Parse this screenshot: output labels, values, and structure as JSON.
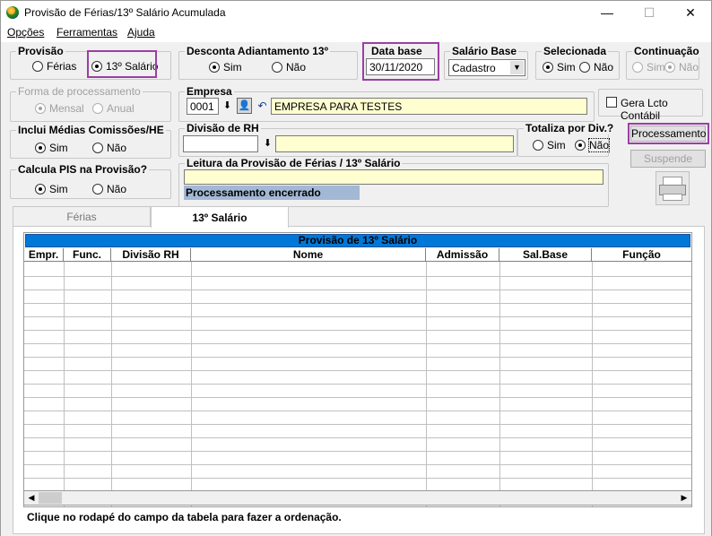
{
  "window": {
    "title": "Provisão de Férias/13º Salário Acumulada",
    "minimize": "—",
    "maximize": "☐",
    "close": "✕"
  },
  "menu": [
    {
      "label": "Opções",
      "key": "O"
    },
    {
      "label": "Ferramentas",
      "key": "F"
    },
    {
      "label": "Ajuda",
      "key": "A"
    }
  ],
  "provisao": {
    "label": "Provisão",
    "ferias": "Férias",
    "salario13": "13º Salário",
    "selected": "13º Salário"
  },
  "desconta": {
    "label": "Desconta Adiantamento 13º",
    "sim": "Sim",
    "nao": "Não",
    "selected": "Sim"
  },
  "data_base": {
    "label": "Data base",
    "value": "30/11/2020"
  },
  "salario_base": {
    "label": "Salário Base",
    "value": "Cadastro"
  },
  "selecionada": {
    "label": "Selecionada",
    "sim": "Sim",
    "nao": "Não",
    "selected": "Sim"
  },
  "continuacao": {
    "label": "Continuação",
    "sim": "Sim",
    "nao": "Não",
    "selected": "Não"
  },
  "forma": {
    "label": "Forma de processamento",
    "mensal": "Mensal",
    "anual": "Anual",
    "selected": "Mensal"
  },
  "empresa": {
    "label": "Empresa",
    "code": "0001",
    "name": "EMPRESA PARA TESTES"
  },
  "gera_lcto": {
    "label": "Gera Lcto Contábil",
    "checked": false
  },
  "inclui": {
    "label": "Inclui Médias Comissões/HE",
    "sim": "Sim",
    "nao": "Não",
    "selected": "Sim"
  },
  "divisao": {
    "label": "Divisão de RH",
    "code": "",
    "name": ""
  },
  "totaliza": {
    "label": "Totaliza por Div.?",
    "sim": "Sim",
    "nao": "Não",
    "selected": "Não"
  },
  "buttons": {
    "processamento": "Processamento",
    "suspende": "Suspende"
  },
  "calcula_pis": {
    "label": "Calcula PIS na Provisão?",
    "sim": "Sim",
    "nao": "Não",
    "selected": "Sim"
  },
  "leitura": {
    "label": "Leitura da Provisão de Férias / 13º Salário",
    "value": "",
    "status": "Processamento encerrado"
  },
  "tabs": [
    {
      "label": "Férias",
      "active": false
    },
    {
      "label": "13º Salário",
      "active": true
    }
  ],
  "grid": {
    "title": "Provisão de 13º Salário",
    "columns": [
      "Empr.",
      "Func.",
      "Divisão RH",
      "Nome",
      "Admissão",
      "Sal.Base",
      "Função"
    ]
  },
  "footer": "Clique no rodapé do campo da tabela  para fazer a ordenação.",
  "colors": {
    "accent": "#0078d7",
    "highlight": "#9b3fa3",
    "yellow_field": "#fffed0",
    "status_bar": "#a3b8d4"
  }
}
